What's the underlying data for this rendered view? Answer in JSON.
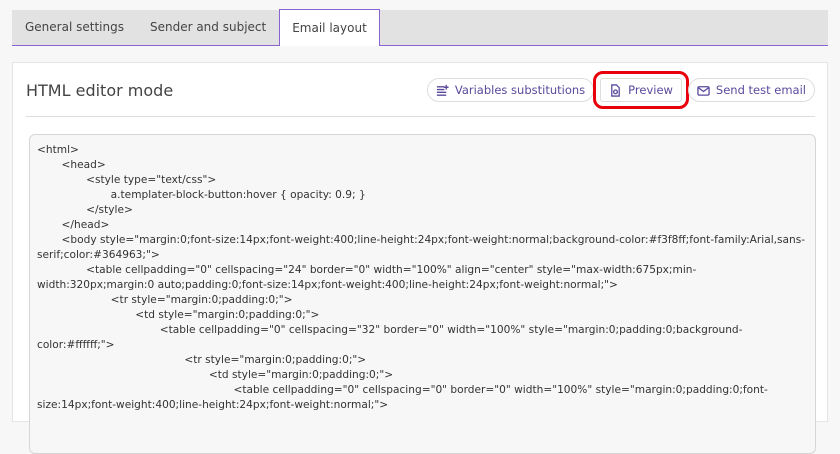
{
  "tabs": [
    {
      "label": "General settings"
    },
    {
      "label": "Sender and subject"
    },
    {
      "label": "Email layout",
      "active": true
    }
  ],
  "editor": {
    "title": "HTML editor mode",
    "buttons": {
      "variables": "Variables substitutions",
      "preview": "Preview",
      "send_test": "Send test email"
    }
  },
  "code_lines": [
    {
      "indent": 0,
      "text": "<html>"
    },
    {
      "indent": 1,
      "text": "<head>"
    },
    {
      "indent": 2,
      "text": "<style type=\"text/css\">"
    },
    {
      "indent": 3,
      "text": "a.templater-block-button:hover { opacity: 0.9; }"
    },
    {
      "indent": 2,
      "text": "</style>"
    },
    {
      "indent": 1,
      "text": "</head>"
    },
    {
      "indent": 1,
      "text": "<body style=\"margin:0;font-size:14px;font-weight:400;line-height:24px;font-weight:normal;background-color:#f3f8ff;font-family:Arial,sans-serif;color:#364963;\">"
    },
    {
      "indent": 2,
      "text": "<table cellpadding=\"0\" cellspacing=\"24\" border=\"0\" width=\"100%\" align=\"center\" style=\"max-width:675px;min-width:320px;margin:0 auto;padding:0;font-size:14px;font-weight:400;line-height:24px;font-weight:normal;\">"
    },
    {
      "indent": 3,
      "text": "<tr style=\"margin:0;padding:0;\">"
    },
    {
      "indent": 4,
      "text": "<td style=\"margin:0;padding:0;\">"
    },
    {
      "indent": 5,
      "text": "<table cellpadding=\"0\" cellspacing=\"32\" border=\"0\" width=\"100%\" style=\"margin:0;padding:0;background-color:#ffffff;\">"
    },
    {
      "indent": 6,
      "text": "<tr style=\"margin:0;padding:0;\">"
    },
    {
      "indent": 7,
      "text": "<td style=\"margin:0;padding:0;\">"
    },
    {
      "indent": 8,
      "text": "<table cellpadding=\"0\" cellspacing=\"0\" border=\"0\" width=\"100%\" style=\"margin:0;padding:0;font-size:14px;font-weight:400;line-height:24px;font-weight:normal;\">"
    }
  ]
}
